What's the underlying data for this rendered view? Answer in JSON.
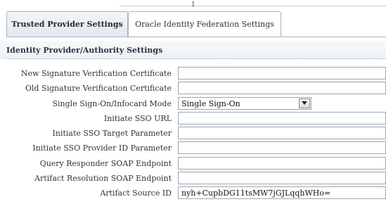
{
  "top_marker": "1",
  "tabs": [
    {
      "label": "Trusted Provider Settings",
      "active": true
    },
    {
      "label": "Oracle Identity Federation Settings",
      "active": false
    }
  ],
  "section": {
    "title": "Identity Provider/Authority Settings"
  },
  "fields": {
    "new_sig_cert": {
      "label": "New Signature Verification Certificate",
      "value": ""
    },
    "old_sig_cert": {
      "label": "Old Signature Verification Certificate",
      "value": ""
    },
    "sso_mode": {
      "label": "Single Sign-On/Infocard Mode",
      "value": "Single Sign-On"
    },
    "initiate_sso_url": {
      "label": "Initiate SSO URL",
      "value": ""
    },
    "initiate_sso_target": {
      "label": "Initiate SSO Target Parameter",
      "value": ""
    },
    "initiate_sso_provider_id": {
      "label": "Initiate SSO Provider ID Parameter",
      "value": ""
    },
    "query_responder": {
      "label": "Query Responder SOAP Endpoint",
      "value": ""
    },
    "artifact_resolution": {
      "label": "Artifact Resolution SOAP Endpoint",
      "value": ""
    },
    "artifact_source_id": {
      "label": "Artifact Source ID",
      "value": "nyh+CupbDG11tsMW7jGJLqqhWHo="
    }
  },
  "icons": {
    "dropdown": "chevron-down-icon"
  }
}
